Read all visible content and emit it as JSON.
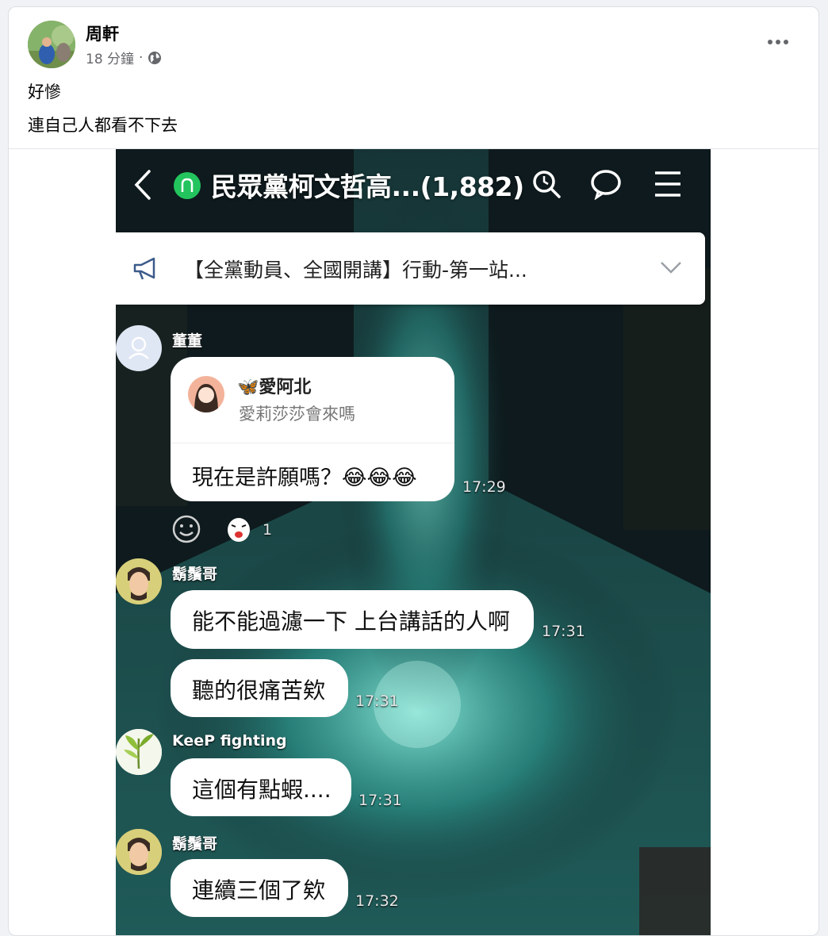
{
  "post": {
    "author": "周軒",
    "time": "18 分鐘",
    "separator": "·",
    "globe_icon": "globe-icon",
    "lines": [
      "好慘",
      "連自己人都看不下去"
    ]
  },
  "chat": {
    "title": "民眾黨柯文哲高...(1,882)",
    "announcement": "【全黨動員、全國開講】行動-第一站...",
    "messages": [
      {
        "sender": "董董",
        "reply_name": "🦋愛阿北",
        "reply_text": "愛莉莎莎會來嗎",
        "text": "現在是許願嗎？😂😂😂",
        "time": "17:29",
        "reaction_count": "1"
      },
      {
        "sender": "鬍鬚哥",
        "text": "能不能過濾一下 上台講話的人啊",
        "time": "17:31"
      },
      {
        "sender": "",
        "text": "聽的很痛苦欸",
        "time": "17:31"
      },
      {
        "sender": "KeeP fighting",
        "text": "這個有點蝦....",
        "time": "17:31"
      },
      {
        "sender": "鬍鬚哥",
        "text": "連續三個了欸",
        "time": "17:32"
      }
    ]
  },
  "colors": {
    "line_green": "#23c45e",
    "card_bg": "#ffffff",
    "page_bg": "#f0f2f5"
  }
}
